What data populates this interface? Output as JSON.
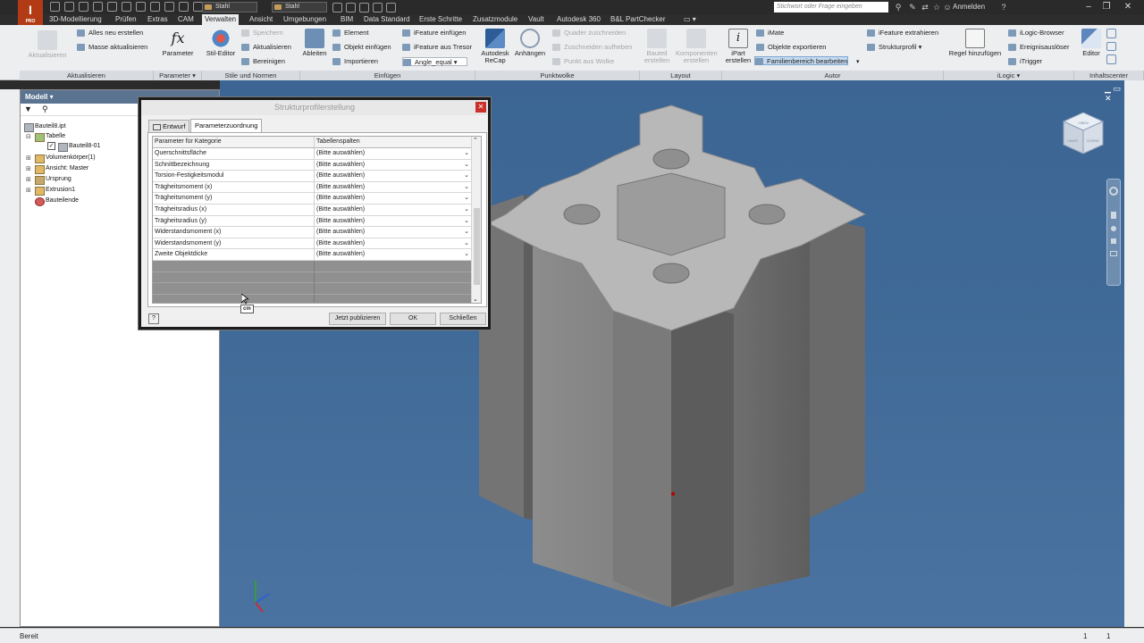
{
  "quick_access": {
    "material": "Stahl",
    "appearance": "Stahl",
    "search_placeholder": "Stichwort oder Frage eingeben",
    "login": "Anmelden"
  },
  "app": {
    "logo_letter": "I",
    "logo_sub": "PRO"
  },
  "tabs": [
    "3D-Modellierung",
    "Prüfen",
    "Extras",
    "CAM",
    "Verwalten",
    "Ansicht",
    "Umgebungen",
    "BIM",
    "Data Standard",
    "Erste Schritte",
    "Zusatzmodule",
    "Vault",
    "Autodesk 360",
    "B&L PartChecker"
  ],
  "active_tab": "Verwalten",
  "ribbon": {
    "aktualisieren": {
      "label": "Aktualisieren",
      "big": "Aktualisieren",
      "items": [
        "Alles neu erstellen",
        "Masse aktualisieren"
      ]
    },
    "parameter": {
      "label": "Parameter",
      "big": "Parameter"
    },
    "stile": {
      "label": "Stile und Normen",
      "big": "Stil-Editor",
      "items": [
        "Speichern",
        "Aktualisieren",
        "Bereinigen"
      ]
    },
    "einfuegen": {
      "label": "Einfügen",
      "big": "Ableiten",
      "items": [
        "Element",
        "Objekt einfügen",
        "Importieren",
        "iFeature einfügen",
        "iFeature aus Tresor",
        "Angle_equal"
      ]
    },
    "punktwolke": {
      "label": "Punktwolke",
      "big1": "Autodesk ReCap",
      "big2": "Anhängen",
      "items": [
        "Quader zuschneiden",
        "Zuschneiden aufheben",
        "Punkt aus Wolke"
      ]
    },
    "layout": {
      "label": "Layout",
      "big1": "Bauteil erstellen",
      "big2": "Komponenten erstellen"
    },
    "autor": {
      "label": "Autor",
      "big": "iPart erstellen",
      "items": [
        "iMate",
        "Objekte exportieren",
        "Familienbereich bearbeiten",
        "iFeature extrahieren",
        "Strukturprofil"
      ]
    },
    "ilogic": {
      "label": "iLogic",
      "big": "Regel hinzufügen",
      "items": [
        "iLogic-Browser",
        "Ereignisauslöser",
        "iTrigger"
      ]
    },
    "inhaltscenter": {
      "label": "Inhaltscenter",
      "big": "Editor"
    }
  },
  "browser": {
    "title": "Modell",
    "tree": [
      "Bauteil8.ipt",
      "Tabelle",
      "Bauteil8-01",
      "Volumenkörper(1)",
      "Ansicht: Master",
      "Ursprung",
      "Extrusion1",
      "Bauteilende"
    ]
  },
  "dialog": {
    "title": "Strukturprofilerstellung",
    "tabs": [
      "Entwurf",
      "Parameterzuordnung"
    ],
    "active_tab": "Parameterzuordnung",
    "columns": [
      "Parameter für Kategorie",
      "Tabellenspalten"
    ],
    "rows": [
      {
        "param": "Querschnittsfläche",
        "col": "(Bitte auswählen)"
      },
      {
        "param": "Schnittbezeichnung",
        "col": "(Bitte auswählen)"
      },
      {
        "param": "Torsion-Festigkeitsmodul",
        "col": "(Bitte auswählen)"
      },
      {
        "param": "Trägheitsmoment (x)",
        "col": "(Bitte auswählen)"
      },
      {
        "param": "Trägheitsmoment (y)",
        "col": "(Bitte auswählen)"
      },
      {
        "param": "Trägheitsradius (x)",
        "col": "(Bitte auswählen)"
      },
      {
        "param": "Trägheitsradius (y)",
        "col": "(Bitte auswählen)"
      },
      {
        "param": "Widerstandsmoment (x)",
        "col": "(Bitte auswählen)"
      },
      {
        "param": "Widerstandsmoment (y)",
        "col": "(Bitte auswählen)"
      },
      {
        "param": "Zweite Objektdicke",
        "col": "(Bitte auswählen)"
      }
    ],
    "tooltip": "cm",
    "buttons": {
      "publish": "Jetzt publizieren",
      "ok": "OK",
      "close": "Schließen"
    }
  },
  "viewcube": {
    "faces": [
      "LINKS",
      "VORNE",
      "OBEN"
    ]
  },
  "status": {
    "text": "Bereit",
    "num1": "1",
    "num2": "1"
  },
  "colors": {
    "accent": "#5a7391",
    "viewport": "#3f6996",
    "brand": "#b23a14"
  }
}
